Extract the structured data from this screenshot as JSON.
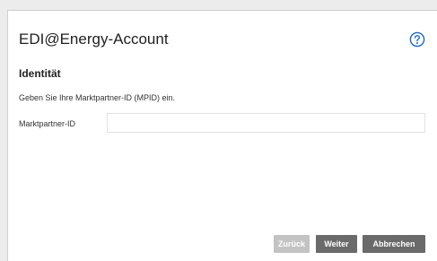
{
  "dialog": {
    "title": "EDI@Energy-Account",
    "help_icon": "question-circle-icon",
    "section_heading": "Identität",
    "instruction": "Geben Sie Ihre Marktpartner-ID (MPID) ein.",
    "field_label": "Marktpartner-ID",
    "field_value": "",
    "field_placeholder": ""
  },
  "buttons": {
    "back_label": "Zurück",
    "next_label": "Weiter",
    "cancel_label": "Abbrechen"
  },
  "colors": {
    "accent": "#1a66c9",
    "button_dark": "#6a6a6a",
    "button_disabled": "#c3c3c3"
  }
}
